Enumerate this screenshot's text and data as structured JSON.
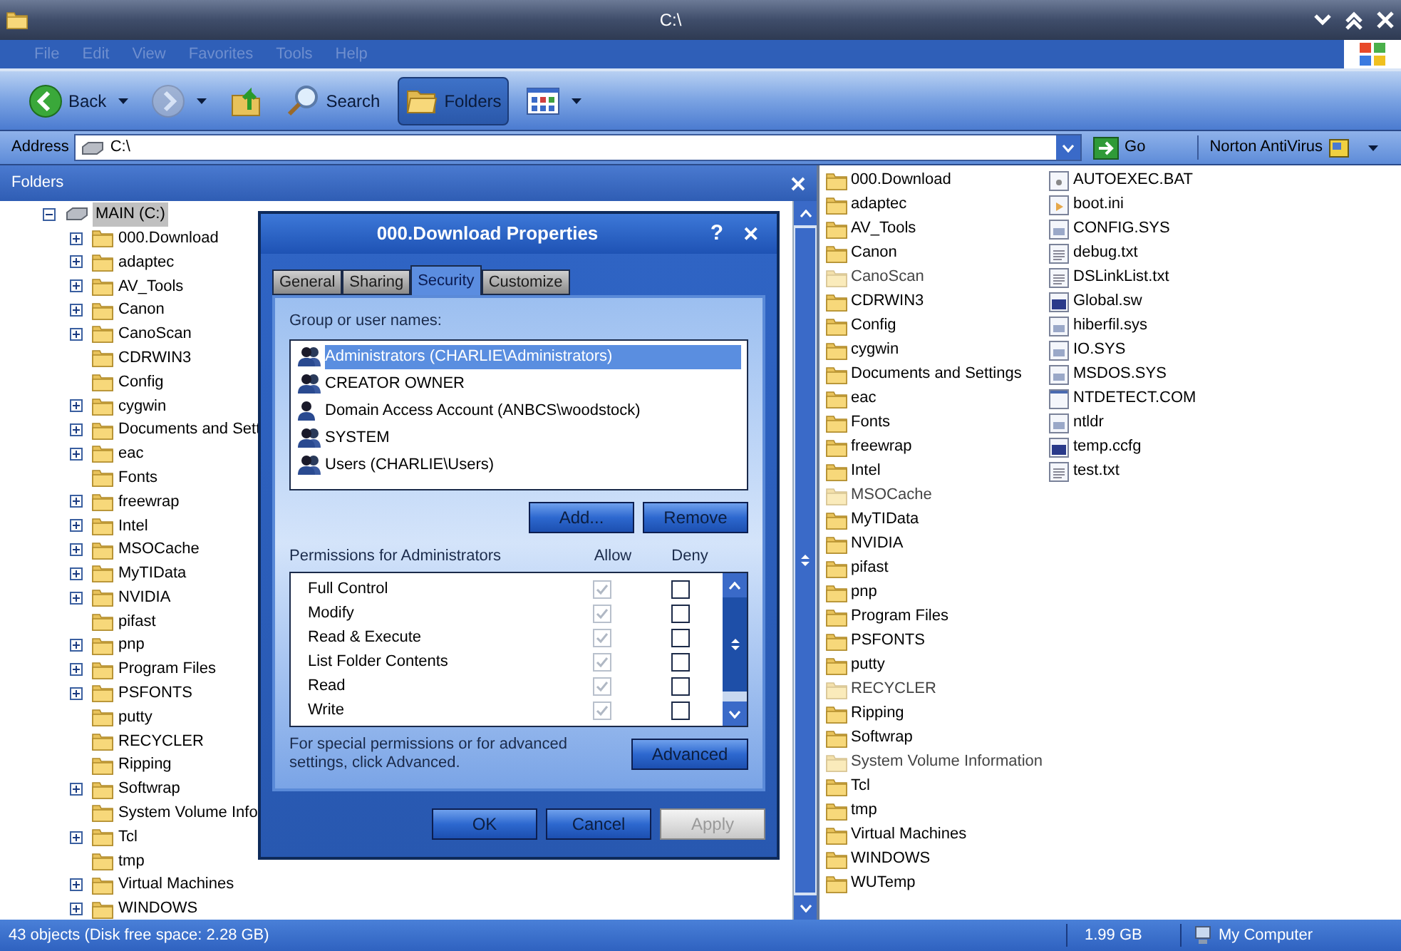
{
  "window": {
    "title": "C:\\"
  },
  "menu": [
    {
      "label": "File",
      "disabled": true
    },
    {
      "label": "Edit",
      "disabled": true
    },
    {
      "label": "View",
      "disabled": true
    },
    {
      "label": "Favorites",
      "disabled": true
    },
    {
      "label": "Tools",
      "disabled": true
    },
    {
      "label": "Help",
      "disabled": true
    }
  ],
  "toolbar": [
    {
      "kind": "back",
      "label": "Back",
      "disabled": false,
      "selected": false
    },
    {
      "kind": "forward",
      "disabled": true,
      "selected": false
    },
    {
      "kind": "up",
      "disabled": false,
      "selected": false
    },
    {
      "kind": "search",
      "label": "Search",
      "disabled": false,
      "selected": false
    },
    {
      "kind": "folders",
      "label": "Folders",
      "disabled": false,
      "selected": true
    },
    {
      "kind": "views",
      "disabled": false,
      "selected": false
    }
  ],
  "address": {
    "label": "Address",
    "value": "C:\\",
    "go": "Go",
    "norton": "Norton AntiVirus"
  },
  "folders_pane": {
    "title": "Folders",
    "root": {
      "label": "MAIN (C:)",
      "expanded": true,
      "selected": true,
      "children": [
        {
          "label": "000.Download",
          "has_children": true
        },
        {
          "label": "adaptec",
          "has_children": true
        },
        {
          "label": "AV_Tools",
          "has_children": true
        },
        {
          "label": "Canon",
          "has_children": true
        },
        {
          "label": "CanoScan",
          "has_children": true
        },
        {
          "label": "CDRWIN3",
          "has_children": false
        },
        {
          "label": "Config",
          "has_children": false
        },
        {
          "label": "cygwin",
          "has_children": true
        },
        {
          "label": "Documents and Sett",
          "has_children": true
        },
        {
          "label": "eac",
          "has_children": true
        },
        {
          "label": "Fonts",
          "has_children": false
        },
        {
          "label": "freewrap",
          "has_children": true
        },
        {
          "label": "Intel",
          "has_children": true
        },
        {
          "label": "MSOCache",
          "has_children": true
        },
        {
          "label": "MyTIData",
          "has_children": true
        },
        {
          "label": "NVIDIA",
          "has_children": true
        },
        {
          "label": "pifast",
          "has_children": false
        },
        {
          "label": "pnp",
          "has_children": true
        },
        {
          "label": "Program Files",
          "has_children": true
        },
        {
          "label": "PSFONTS",
          "has_children": true
        },
        {
          "label": "putty",
          "has_children": false
        },
        {
          "label": "RECYCLER",
          "has_children": false
        },
        {
          "label": "Ripping",
          "has_children": false
        },
        {
          "label": "Softwrap",
          "has_children": true
        },
        {
          "label": "System Volume Info",
          "has_children": false
        },
        {
          "label": "Tcl",
          "has_children": true
        },
        {
          "label": "tmp",
          "has_children": false
        },
        {
          "label": "Virtual Machines",
          "has_children": true
        },
        {
          "label": "WINDOWS",
          "has_children": true
        }
      ]
    }
  },
  "files": [
    {
      "name": "000.Download",
      "kind": "folder",
      "hidden": false
    },
    {
      "name": "adaptec",
      "kind": "folder",
      "hidden": false
    },
    {
      "name": "AV_Tools",
      "kind": "folder",
      "hidden": false
    },
    {
      "name": "Canon",
      "kind": "folder",
      "hidden": false
    },
    {
      "name": "CanoScan",
      "kind": "folder",
      "hidden": true
    },
    {
      "name": "CDRWIN3",
      "kind": "folder",
      "hidden": false
    },
    {
      "name": "Config",
      "kind": "folder",
      "hidden": false
    },
    {
      "name": "cygwin",
      "kind": "folder",
      "hidden": false
    },
    {
      "name": "Documents and Settings",
      "kind": "folder",
      "hidden": false
    },
    {
      "name": "eac",
      "kind": "folder",
      "hidden": false
    },
    {
      "name": "Fonts",
      "kind": "folder",
      "hidden": false
    },
    {
      "name": "freewrap",
      "kind": "folder",
      "hidden": false
    },
    {
      "name": "Intel",
      "kind": "folder",
      "hidden": false
    },
    {
      "name": "MSOCache",
      "kind": "folder",
      "hidden": true
    },
    {
      "name": "MyTIData",
      "kind": "folder",
      "hidden": false
    },
    {
      "name": "NVIDIA",
      "kind": "folder",
      "hidden": false
    },
    {
      "name": "pifast",
      "kind": "folder",
      "hidden": false
    },
    {
      "name": "pnp",
      "kind": "folder",
      "hidden": false
    },
    {
      "name": "Program Files",
      "kind": "folder",
      "hidden": false
    },
    {
      "name": "PSFONTS",
      "kind": "folder",
      "hidden": false
    },
    {
      "name": "putty",
      "kind": "folder",
      "hidden": false
    },
    {
      "name": "RECYCLER",
      "kind": "folder",
      "hidden": true
    },
    {
      "name": "Ripping",
      "kind": "folder",
      "hidden": false
    },
    {
      "name": "Softwrap",
      "kind": "folder",
      "hidden": false
    },
    {
      "name": "System Volume Information",
      "kind": "folder",
      "hidden": true
    },
    {
      "name": "Tcl",
      "kind": "folder",
      "hidden": false
    },
    {
      "name": "tmp",
      "kind": "folder",
      "hidden": false
    },
    {
      "name": "Virtual Machines",
      "kind": "folder",
      "hidden": false
    },
    {
      "name": "WINDOWS",
      "kind": "folder",
      "hidden": false
    },
    {
      "name": "WUTemp",
      "kind": "folder",
      "hidden": false
    },
    {
      "name": "AUTOEXEC.BAT",
      "kind": "batch",
      "hidden": false
    },
    {
      "name": "boot.ini",
      "kind": "settings",
      "hidden": false
    },
    {
      "name": "CONFIG.SYS",
      "kind": "system",
      "hidden": false
    },
    {
      "name": "debug.txt",
      "kind": "text",
      "hidden": false
    },
    {
      "name": "DSLinkList.txt",
      "kind": "text",
      "hidden": false
    },
    {
      "name": "Global.sw",
      "kind": "program",
      "hidden": false
    },
    {
      "name": "hiberfil.sys",
      "kind": "system",
      "hidden": false
    },
    {
      "name": "IO.SYS",
      "kind": "system",
      "hidden": false
    },
    {
      "name": "MSDOS.SYS",
      "kind": "system",
      "hidden": false
    },
    {
      "name": "NTDETECT.COM",
      "kind": "window",
      "hidden": false
    },
    {
      "name": "ntldr",
      "kind": "system",
      "hidden": false
    },
    {
      "name": "temp.ccfg",
      "kind": "program",
      "hidden": false
    },
    {
      "name": "test.txt",
      "kind": "text",
      "hidden": false
    }
  ],
  "dialog": {
    "title": "000.Download Properties",
    "help": "?",
    "close": "✕",
    "tabs": [
      {
        "label": "General",
        "selected": false
      },
      {
        "label": "Sharing",
        "selected": false
      },
      {
        "label": "Security",
        "selected": true
      },
      {
        "label": "Customize",
        "selected": false
      }
    ],
    "group_label": "Group or user names:",
    "users": [
      {
        "name": "Administrators (CHARLIE\\Administrators)",
        "kind": "group",
        "selected": true
      },
      {
        "name": "CREATOR OWNER",
        "kind": "group",
        "selected": false
      },
      {
        "name": "Domain Access Account (ANBCS\\woodstock)",
        "kind": "user",
        "selected": false
      },
      {
        "name": "SYSTEM",
        "kind": "group",
        "selected": false
      },
      {
        "name": "Users (CHARLIE\\Users)",
        "kind": "group",
        "selected": false
      }
    ],
    "add": "Add...",
    "remove": "Remove",
    "permissions_label": "Permissions for Administrators",
    "allow_header": "Allow",
    "deny_header": "Deny",
    "permissions": [
      {
        "name": "Full Control",
        "allow": true,
        "deny": false
      },
      {
        "name": "Modify",
        "allow": true,
        "deny": false
      },
      {
        "name": "Read & Execute",
        "allow": true,
        "deny": false
      },
      {
        "name": "List Folder Contents",
        "allow": true,
        "deny": false
      },
      {
        "name": "Read",
        "allow": true,
        "deny": false
      },
      {
        "name": "Write",
        "allow": true,
        "deny": false
      }
    ],
    "advanced_note": "For special permissions or for advanced settings, click Advanced.",
    "advanced": "Advanced",
    "buttons": [
      {
        "label": "OK",
        "disabled": false
      },
      {
        "label": "Cancel",
        "disabled": false
      },
      {
        "label": "Apply",
        "disabled": true
      }
    ]
  },
  "status_bar": {
    "objects": "43 objects (Disk free space: 2.28 GB)",
    "size": "1.99 GB",
    "location": "My Computer"
  }
}
